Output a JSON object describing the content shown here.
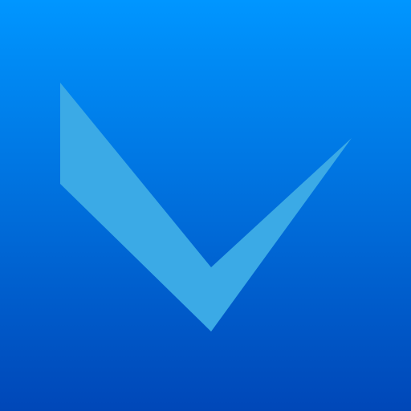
{
  "icon": {
    "glyph": "checkmark-icon",
    "colors": {
      "background_top": "#0096FF",
      "background_bottom": "#0047B8",
      "checkmark": "#3BAAE6"
    }
  }
}
